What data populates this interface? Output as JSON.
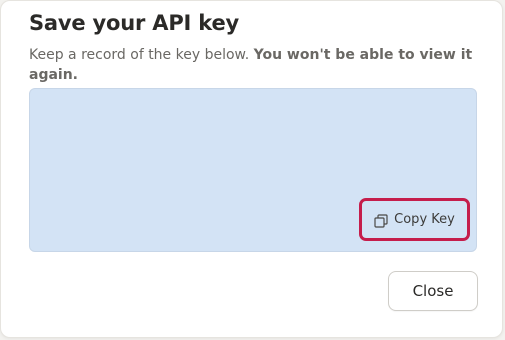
{
  "dialog": {
    "title": "Save your API key",
    "description_plain": "Keep a record of the key below.",
    "description_strong": "You won't be able to view it again.",
    "key_value": "",
    "copy_button_label": "Copy Key",
    "copy_icon": "copy-icon",
    "close_button_label": "Close"
  },
  "colors": {
    "key_box_background": "#d3e3f5",
    "highlight_border": "#c51d4b",
    "title_text": "#2b2a28",
    "muted_text": "#6a6864"
  }
}
